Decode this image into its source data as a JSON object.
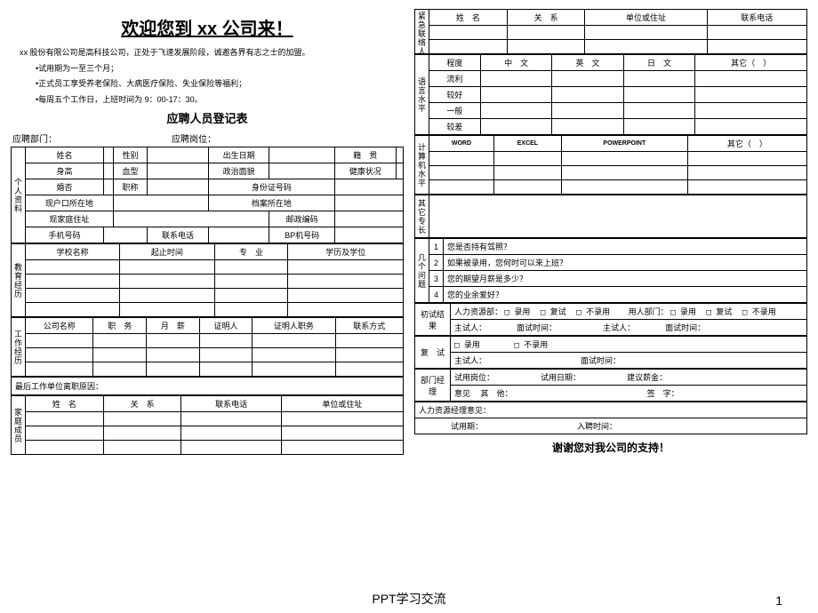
{
  "header": {
    "title": "欢迎您到 xx 公司来！",
    "intro_line": "xx 股份有限公司是高科技公司，正处于飞速发展阶段，诚邀各界有志之士的加盟。",
    "bullet1": "•试用期为一至三个月；",
    "bullet2": "•正式员工享受养老保险、大病医疗保险、失业保险等福利；",
    "bullet3": "•每周五个工作日，上班时间为 9：00-17：30。",
    "form_title": "应聘人员登记表",
    "apply_dept": "应聘部门：",
    "apply_post": "应聘岗位："
  },
  "left": {
    "personal_label": "个人资料",
    "name": "姓名",
    "gender": "性别",
    "birth": "出生日期",
    "origin": "籍　贯",
    "height": "身高",
    "blood": "血型",
    "politics": "政治面貌",
    "health": "健康状况",
    "marriage": "婚否",
    "title": "职称",
    "idno": "身份证号码",
    "hukou": "现户口所在地",
    "archive": "档案所在地",
    "addr": "现家庭住址",
    "zip": "邮政编码",
    "mobile": "手机号码",
    "phone": "联系电话",
    "bp": "BP机号码",
    "edu_label": "教育经历",
    "school": "学校名称",
    "period": "起止时间",
    "major": "专　业",
    "degree": "学历及学位",
    "work_label": "工作经历",
    "company": "公司名称",
    "duty": "职　务",
    "salary": "月　薪",
    "ref": "证明人",
    "refjob": "证明人职务",
    "refcontact": "联系方式",
    "leave_reason": "最后工作单位离职原因：",
    "family_label": "家庭成员",
    "fam_name": "姓　名",
    "fam_rel": "关　系",
    "fam_phone": "联系电话",
    "fam_addr": "单位或住址"
  },
  "right": {
    "emerg_label": "紧急联络人",
    "e_name": "姓　名",
    "e_rel": "关　系",
    "e_addr": "单位或住址",
    "e_phone": "联系电话",
    "lang_label": "语言水平",
    "level": "程度",
    "cn": "中　文",
    "en": "英　文",
    "jp": "日　文",
    "other": "其它（　）",
    "lv1": "流利",
    "lv2": "较好",
    "lv3": "一般",
    "lv4": "较差",
    "comp_label": "计算机水平",
    "word": "WORD",
    "excel": "EXCEL",
    "ppt": "POWERPOINT",
    "other2": "其它（　）",
    "skill_label": "其它专长",
    "q_label": "几个问题",
    "q1n": "1",
    "q1": "您是否持有驾照？",
    "q2n": "2",
    "q2": "如果被录用，您何时可以来上班？",
    "q3n": "3",
    "q3": "您的期望月薪是多少？",
    "q4n": "4",
    "q4": "您的业余爱好？",
    "init_result": "初试结果",
    "hr_dept": "人力资源部：",
    "use_dept": "用人部门：",
    "opt_hire": "□ 录用",
    "opt_retest": "□ 复试",
    "opt_reject": "□ 不录用",
    "examiner": "主试人：",
    "interview_time": "面试时间：",
    "retest": "复　试",
    "retest_opts": "□ 录用　　　　□ 不录用",
    "dept_mgr": "部门经理",
    "try_post": "试用岗位：",
    "try_period": "试用日期：",
    "sugg_salary": "建议薪金：",
    "opinion": "意见",
    "other3": "其　他：",
    "sign": "签　字：",
    "hr_mgr_op": "人力资源经理意见：",
    "try_use": "试用期：",
    "hire_time": "入聘时间："
  },
  "thanks": "谢谢您对我公司的支持！",
  "footer": "PPT学习交流",
  "page_num": "1"
}
